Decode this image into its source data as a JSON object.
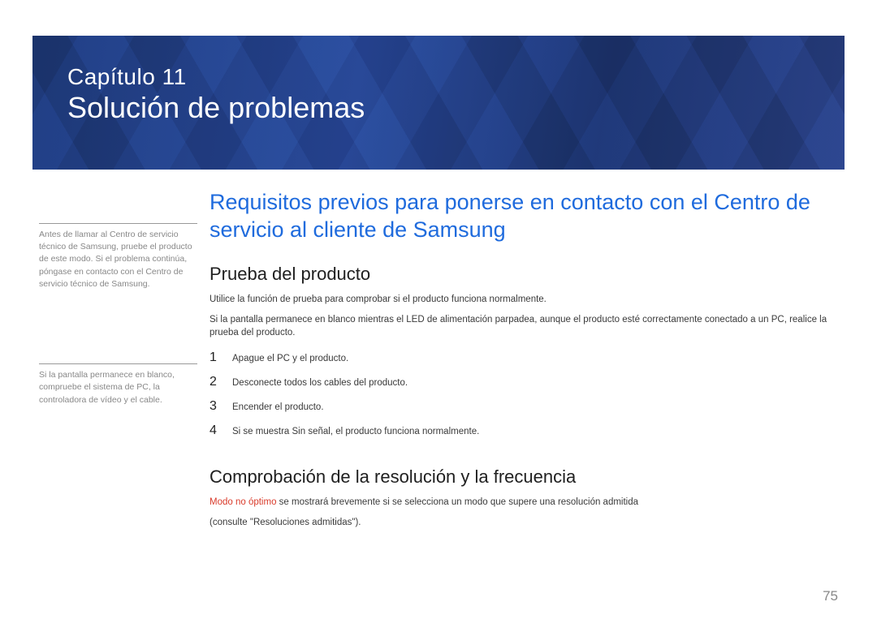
{
  "header": {
    "chapter_label": "Capítulo 11",
    "chapter_title": "Solución de problemas"
  },
  "side_notes": [
    "Antes de llamar al Centro de servicio técnico de Samsung, pruebe el producto de este modo. Si el problema continúa, póngase en contacto con el Centro de servicio técnico de Samsung.",
    "Si la pantalla permanece en blanco, compruebe el sistema de PC, la controladora de vídeo y el cable."
  ],
  "main": {
    "section_heading": "Requisitos previos para ponerse en contacto con el Centro de servicio al cliente de Samsung",
    "sub1_heading": "Prueba del producto",
    "sub1_paragraphs": [
      "Utilice la función de prueba para comprobar si el producto funciona normalmente.",
      "Si la pantalla permanece en blanco mientras el LED de alimentación parpadea, aunque el producto esté correctamente conectado a un PC, realice la prueba del producto."
    ],
    "steps": [
      "Apague el PC y el producto.",
      "Desconecte todos los cables del producto.",
      "Encender el producto.",
      {
        "prefix": "Si se muestra ",
        "red": "Sin señal",
        "suffix": ", el producto funciona normalmente."
      }
    ],
    "sub2_heading": "Comprobación de la resolución y la frecuencia",
    "sub2_line1": {
      "red": "Modo no óptimo",
      "tail": " se mostrará brevemente si se selecciona un modo que supere una resolución admitida"
    },
    "sub2_line2": "(consulte \"Resoluciones admitidas\")."
  },
  "page_number": "75"
}
